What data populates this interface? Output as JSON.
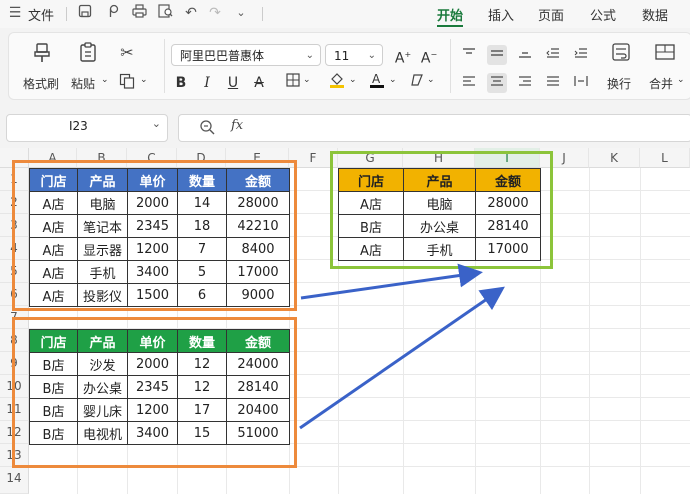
{
  "menubar": {
    "file_label": "文件",
    "tabs": [
      {
        "label": "开始",
        "active": true
      },
      {
        "label": "插入",
        "active": false
      },
      {
        "label": "页面",
        "active": false
      },
      {
        "label": "公式",
        "active": false
      },
      {
        "label": "数据",
        "active": false
      }
    ],
    "accent": "#1a7a3c"
  },
  "ribbon": {
    "format_painter": "格式刷",
    "paste": "粘贴",
    "font_name": "阿里巴巴普惠体",
    "font_size": "11",
    "wrap_text": "换行",
    "merge": "合并"
  },
  "formula_bar": {
    "name_box": "I23",
    "fx_label": "fx",
    "content": ""
  },
  "sheet": {
    "columns": [
      "A",
      "B",
      "C",
      "D",
      "E",
      "F",
      "G",
      "H",
      "I",
      "J",
      "K",
      "L"
    ],
    "selected_column": "I",
    "rows": [
      "1",
      "2",
      "3",
      "4",
      "5",
      "6",
      "7",
      "8",
      "9",
      "10",
      "11",
      "12",
      "13",
      "14"
    ],
    "table_a": {
      "header": [
        "门店",
        "产品",
        "单价",
        "数量",
        "金额"
      ],
      "header_color": "#4472c4",
      "rows": [
        [
          "A店",
          "电脑",
          "2000",
          "14",
          "28000"
        ],
        [
          "A店",
          "笔记本",
          "2345",
          "18",
          "42210"
        ],
        [
          "A店",
          "显示器",
          "1200",
          "7",
          "8400"
        ],
        [
          "A店",
          "手机",
          "3400",
          "5",
          "17000"
        ],
        [
          "A店",
          "投影仪",
          "1500",
          "6",
          "9000"
        ]
      ]
    },
    "table_b": {
      "header": [
        "门店",
        "产品",
        "单价",
        "数量",
        "金额"
      ],
      "header_color": "#1fa046",
      "rows": [
        [
          "B店",
          "沙发",
          "2000",
          "12",
          "24000"
        ],
        [
          "B店",
          "办公桌",
          "2345",
          "12",
          "28140"
        ],
        [
          "B店",
          "婴儿床",
          "1200",
          "17",
          "20400"
        ],
        [
          "B店",
          "电视机",
          "3400",
          "15",
          "51000"
        ]
      ]
    },
    "result_table": {
      "header": [
        "门店",
        "产品",
        "金额"
      ],
      "header_color": "#f2b200",
      "rows": [
        [
          "A店",
          "电脑",
          "28000"
        ],
        [
          "B店",
          "办公桌",
          "28140"
        ],
        [
          "A店",
          "手机",
          "17000"
        ]
      ]
    },
    "frame_colors": {
      "source": "#ed8a3c",
      "result": "#8cc43a",
      "arrow": "#3a62c8"
    }
  }
}
